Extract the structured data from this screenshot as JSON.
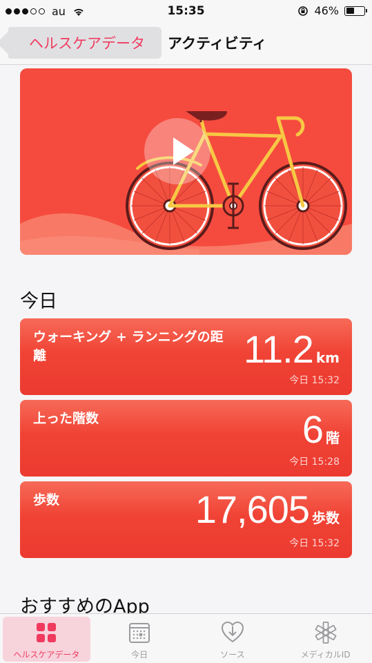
{
  "status_bar": {
    "carrier": "au",
    "time": "15:35",
    "battery": "46%"
  },
  "nav": {
    "back_label": "ヘルスケアデータ",
    "title": "アクティビティ"
  },
  "sections": {
    "today": "今日",
    "recommended": "おすすめのApp"
  },
  "cards": [
    {
      "label": "ウォーキング + ランニングの距離",
      "value": "11.2",
      "unit": "km",
      "time": "今日 15:32"
    },
    {
      "label": "上った階数",
      "value": "6",
      "unit": "階",
      "time": "今日 15:28"
    },
    {
      "label": "歩数",
      "value": "17,605",
      "unit": "歩数",
      "time": "今日 15:32"
    }
  ],
  "tabs": [
    {
      "label": "ヘルスケアデータ",
      "icon": "grid-icon",
      "active": true
    },
    {
      "label": "今日",
      "icon": "calendar-icon",
      "active": false
    },
    {
      "label": "ソース",
      "icon": "sources-heart-icon",
      "active": false
    },
    {
      "label": "メディカルID",
      "icon": "medical-star-icon",
      "active": false
    }
  ],
  "colors": {
    "accent": "#f13a5e",
    "card_red": "#f04335",
    "hero_red": "#f54b3e"
  }
}
